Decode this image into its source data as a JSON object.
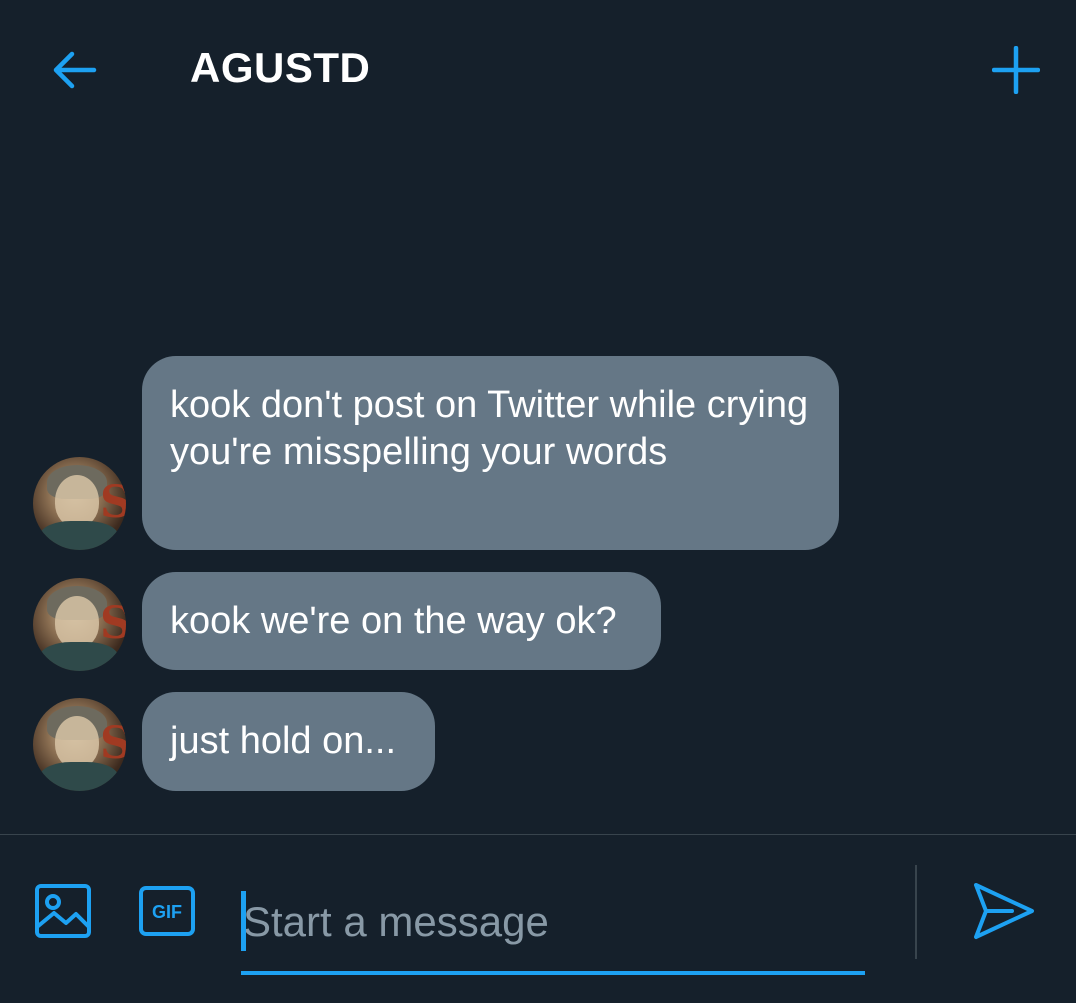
{
  "header": {
    "back_icon": "arrow-left-icon",
    "title": "AGUSTD",
    "add_icon": "plus-icon"
  },
  "messages": [
    {
      "sender_avatar": "avatar",
      "text": "kook don't post on Twitter while crying you're misspelling your words"
    },
    {
      "sender_avatar": "avatar",
      "text": "kook we're on the way ok?"
    },
    {
      "sender_avatar": "avatar",
      "text": "just hold on..."
    }
  ],
  "composer": {
    "image_icon": "image-icon",
    "gif_label": "GIF",
    "placeholder": "Start a message",
    "value": "",
    "send_icon": "send-icon"
  },
  "colors": {
    "background": "#15202b",
    "accent": "#1da1f2",
    "bubble": "#657786",
    "placeholder": "#8899a6",
    "divider": "#38444d"
  }
}
